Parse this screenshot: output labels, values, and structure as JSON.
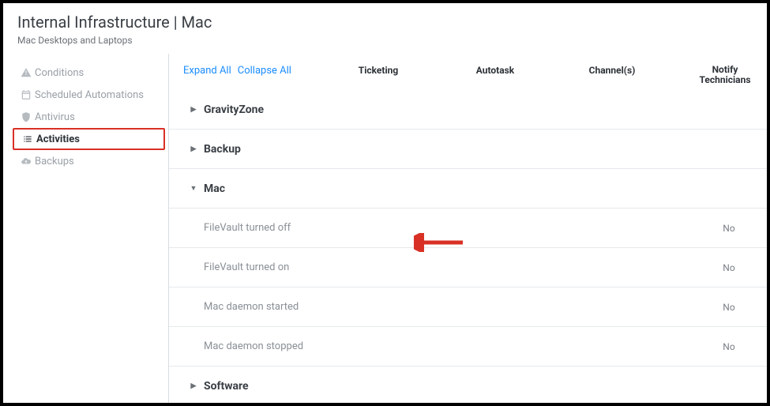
{
  "header": {
    "title": "Internal Infrastructure | Mac",
    "subtitle": "Mac Desktops and Laptops"
  },
  "sidebar": {
    "items": [
      {
        "label": "Conditions"
      },
      {
        "label": "Scheduled Automations"
      },
      {
        "label": "Antivirus"
      },
      {
        "label": "Activities"
      },
      {
        "label": "Backups"
      }
    ]
  },
  "controls": {
    "expand_all": "Expand All",
    "collapse_all": "Collapse All"
  },
  "columns": {
    "ticketing": "Ticketing",
    "autotask": "Autotask",
    "channels": "Channel(s)",
    "notify": "Notify Technicians"
  },
  "groups": [
    {
      "label": "GravityZone",
      "expanded": false
    },
    {
      "label": "Backup",
      "expanded": false
    },
    {
      "label": "Mac",
      "expanded": true,
      "items": [
        {
          "label": "FileVault turned off",
          "notify": "No"
        },
        {
          "label": "FileVault turned on",
          "notify": "No"
        },
        {
          "label": "Mac daemon started",
          "notify": "No"
        },
        {
          "label": "Mac daemon stopped",
          "notify": "No"
        }
      ]
    },
    {
      "label": "Software",
      "expanded": false
    }
  ],
  "annotation": {
    "arrow_color": "#d93025"
  }
}
